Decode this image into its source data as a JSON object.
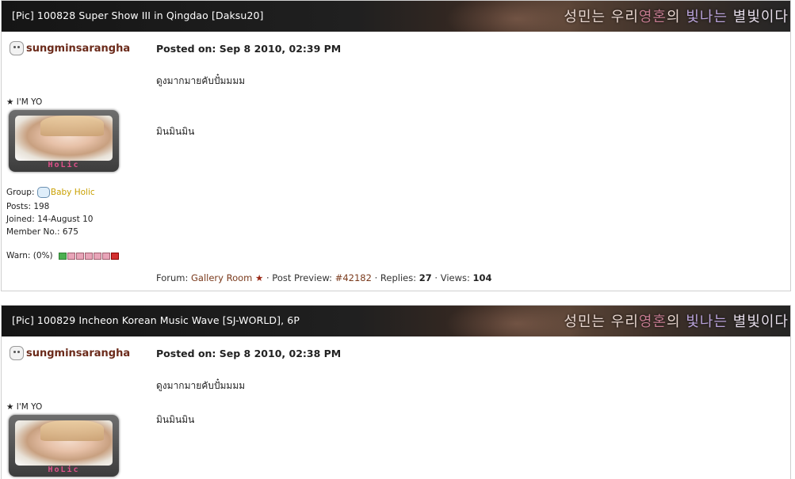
{
  "posts": [
    {
      "title": "[Pic] 100828 Super Show III in Qingdao [Daksu20]",
      "banner_text": [
        "성민는 우리",
        "영혼",
        "의 ",
        "빛나는",
        " 별빛이다"
      ],
      "author": "sungminsarangha",
      "member_title": "I'M YO",
      "avatar_text": "HoLic",
      "group_label": "Group:",
      "group_value": "Baby Holic",
      "posts_line": "Posts: 198",
      "joined_line": "Joined: 14-August 10",
      "member_no_line": "Member No.: 675",
      "warn_label": "Warn: (0%)",
      "posted_on": "Posted on: Sep 8 2010, 02:39 PM",
      "body_line1": "ดูงมากมายคับปั๋มมมม",
      "body_line2": "มินมินมิน",
      "footer": {
        "forum_label": "Forum:",
        "forum_value": "Gallery Room",
        "star": "★",
        "preview_label": "· Post Preview:",
        "preview_value": "#42182",
        "replies_label": "· Replies:",
        "replies_value": "27",
        "views_label": "· Views:",
        "views_value": "104"
      }
    },
    {
      "title": "[Pic] 100829 Incheon Korean Music Wave [SJ-WORLD], 6P",
      "banner_text": [
        "성민는 우리",
        "영혼",
        "의 ",
        "빛나는",
        " 별빛이다"
      ],
      "author": "sungminsarangha",
      "member_title": "I'M YO",
      "avatar_text": "HoLic",
      "posted_on": "Posted on: Sep 8 2010, 02:38 PM",
      "body_line1": "ดูงมากมายคับปั๋มมมม",
      "body_line2": "มินมินมิน"
    }
  ],
  "colors": {
    "author": "#6b2a1a",
    "group_value": "#c9a000",
    "footer_link": "#7a3a1c"
  },
  "icons": {
    "author": "user-face-icon",
    "title_star": "star-icon",
    "group": "group-badge-icon",
    "forum_star": "star-icon"
  }
}
